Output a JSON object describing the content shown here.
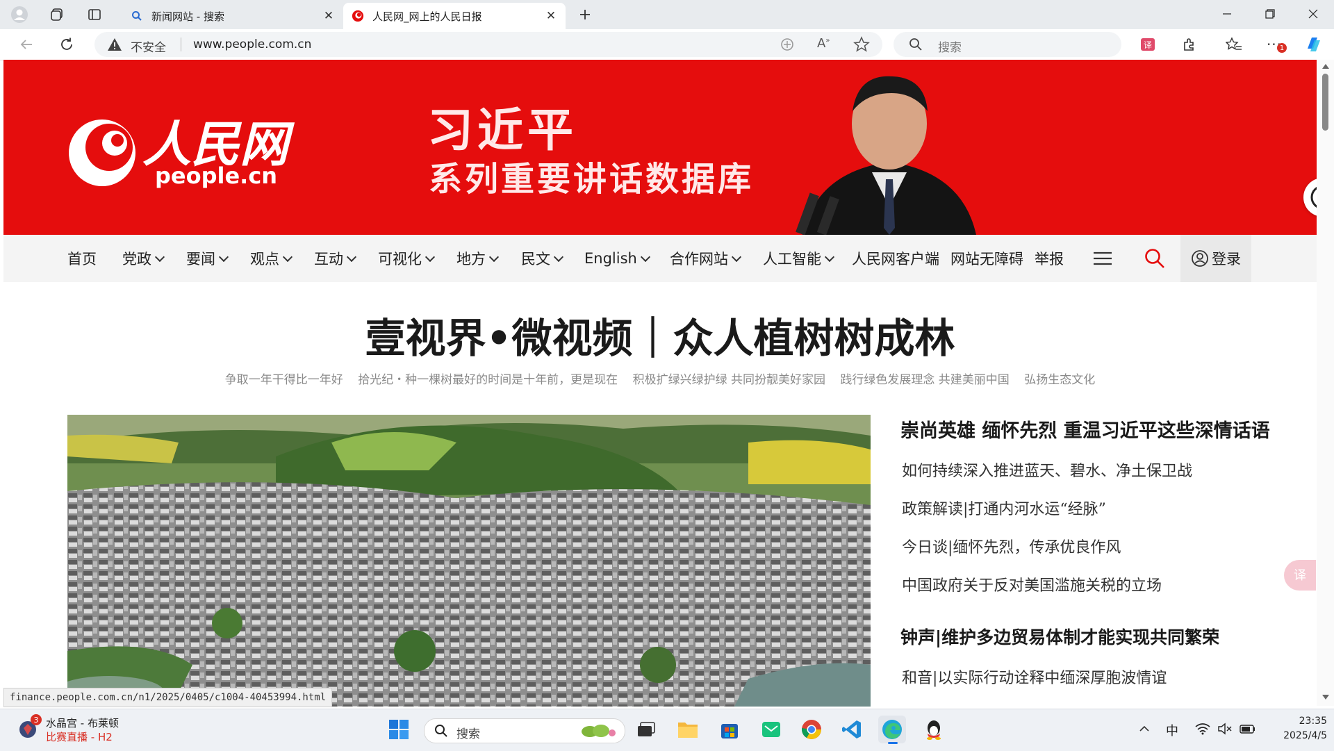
{
  "browser": {
    "tabs": [
      {
        "title": "新闻网站 - 搜索",
        "icon": "search-icon"
      },
      {
        "title": "人民网_网上的人民日报",
        "icon": "people-logo-icon"
      }
    ],
    "address": {
      "security_label": "不安全",
      "url": "www.people.com.cn"
    },
    "search_placeholder": "搜索",
    "notification_badge": "1"
  },
  "banner": {
    "logo_text": "人民网",
    "logo_domain": "people.cn",
    "title_line1": "习近平",
    "title_line2": "系列重要讲话数据库"
  },
  "nav": {
    "items": [
      {
        "label": "首页",
        "dropdown": false
      },
      {
        "label": "党政",
        "dropdown": true
      },
      {
        "label": "要闻",
        "dropdown": true
      },
      {
        "label": "观点",
        "dropdown": true
      },
      {
        "label": "互动",
        "dropdown": true
      },
      {
        "label": "可视化",
        "dropdown": true
      },
      {
        "label": "地方",
        "dropdown": true
      },
      {
        "label": "民文",
        "dropdown": true
      },
      {
        "label": "English",
        "dropdown": true
      },
      {
        "label": "合作网站",
        "dropdown": true
      },
      {
        "label": "人工智能",
        "dropdown": true
      },
      {
        "label": "人民网客户端",
        "dropdown": false
      },
      {
        "label": "网站无障碍",
        "dropdown": false
      },
      {
        "label": "举报",
        "dropdown": false
      }
    ],
    "login_label": "登录"
  },
  "main": {
    "headline": "壹视界•微视频｜众人植树树成林",
    "subheads": [
      "争取一年干得比一年好",
      "拾光纪・种一棵树最好的时间是十年前，更是现在",
      "积极扩绿兴绿护绿 共同扮靓美好家园",
      "践行绿色发展理念 共建美丽中国",
      "弘扬生态文化"
    ],
    "news": [
      {
        "text": "崇尚英雄 缅怀先烈 重温习近平这些深情话语",
        "type": "headline"
      },
      {
        "text": "如何持续深入推进蓝天、碧水、净土保卫战",
        "type": "item"
      },
      {
        "text": "政策解读|打通内河水运“经脉”",
        "type": "item"
      },
      {
        "text": "今日谈|缅怀先烈，传承优良作风",
        "type": "item"
      },
      {
        "text": "中国政府关于反对美国滥施关税的立场",
        "type": "item"
      },
      {
        "text": "钟声|维护多边贸易体制才能实现共同繁荣",
        "type": "headline"
      },
      {
        "text": "和音|以实际行动诠释中缅深厚胞波情谊",
        "type": "item"
      }
    ]
  },
  "status_url": "finance.people.com.cn/n1/2025/0405/c1004-40453994.html",
  "taskbar": {
    "widget_title": "水晶宫 - 布莱顿",
    "widget_sub": "比赛直播 - H2",
    "widget_badge": "3",
    "search_placeholder": "搜索",
    "ime": "中",
    "time": "23:35",
    "date": "2025/4/5"
  },
  "colors": {
    "brand_red": "#e50d0d",
    "nav_bg": "#f4f4f4",
    "taskbar_bg": "#eef1f5"
  }
}
